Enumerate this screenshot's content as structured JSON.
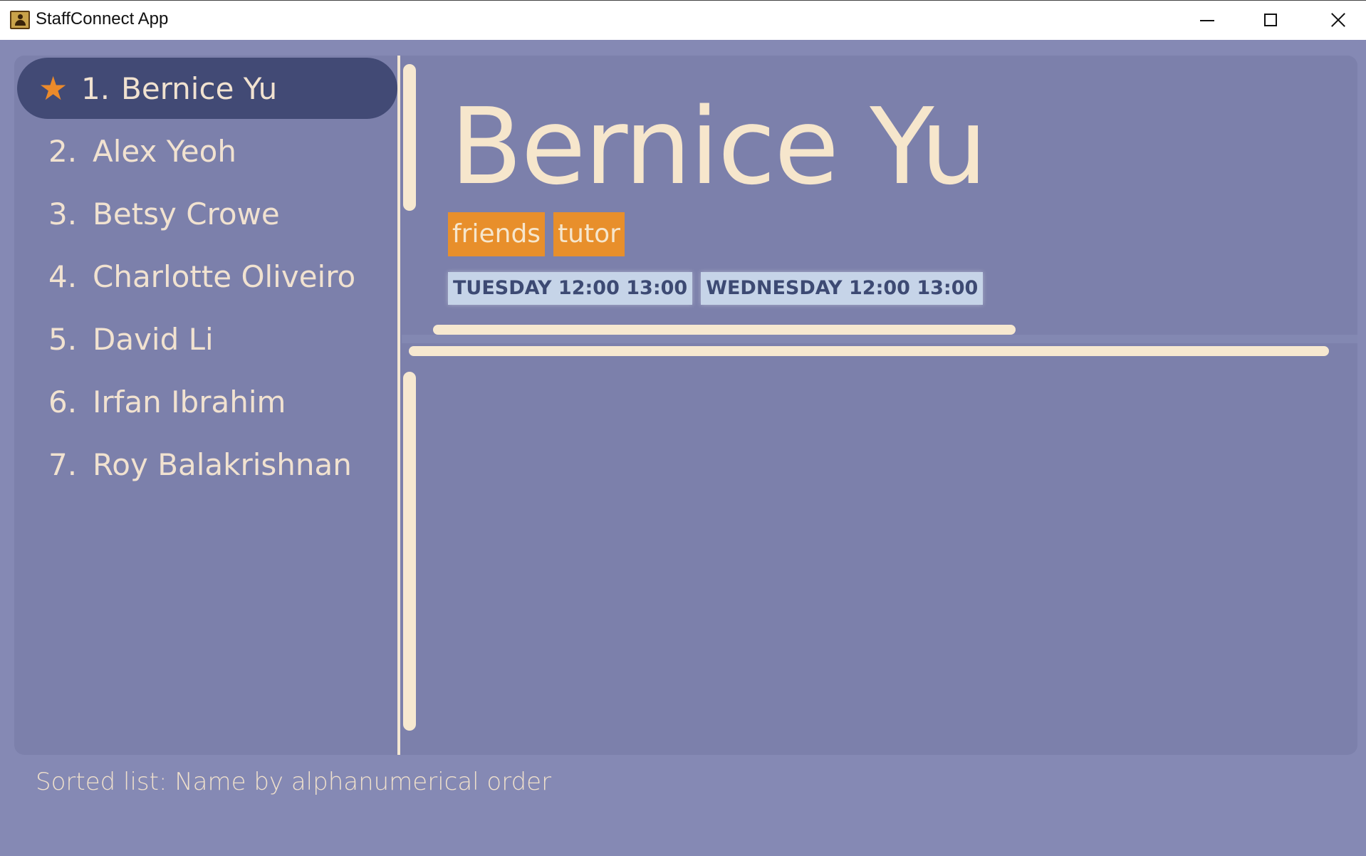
{
  "window": {
    "title": "StaffConnect App",
    "icon": "contact-book-icon"
  },
  "person_list": [
    {
      "index": "1.",
      "name": "Bernice Yu",
      "selected": true,
      "favourite": true
    },
    {
      "index": "2.",
      "name": "Alex Yeoh",
      "selected": false,
      "favourite": false
    },
    {
      "index": "3.",
      "name": "Betsy Crowe",
      "selected": false,
      "favourite": false
    },
    {
      "index": "4.",
      "name": "Charlotte Oliveiro",
      "selected": false,
      "favourite": false
    },
    {
      "index": "5.",
      "name": "David Li",
      "selected": false,
      "favourite": false
    },
    {
      "index": "6.",
      "name": "Irfan Ibrahim",
      "selected": false,
      "favourite": false
    },
    {
      "index": "7.",
      "name": "Roy Balakrishnan",
      "selected": false,
      "favourite": false
    }
  ],
  "detail": {
    "name": "Bernice Yu",
    "tags": [
      "friends",
      "tutor"
    ],
    "availabilities": [
      "TUESDAY 12:00 13:00",
      "WEDNESDAY 12:00 13:00"
    ]
  },
  "status": {
    "text": "Sorted list: Name by alphanumerical order"
  },
  "colors": {
    "background": "#8589b4",
    "panel": "#7c80ab",
    "selected_row": "#424a75",
    "star": "#ec8a2a",
    "tag": "#e88f2b",
    "availability": "#c6d4e8",
    "text": "#f1e2d0"
  }
}
